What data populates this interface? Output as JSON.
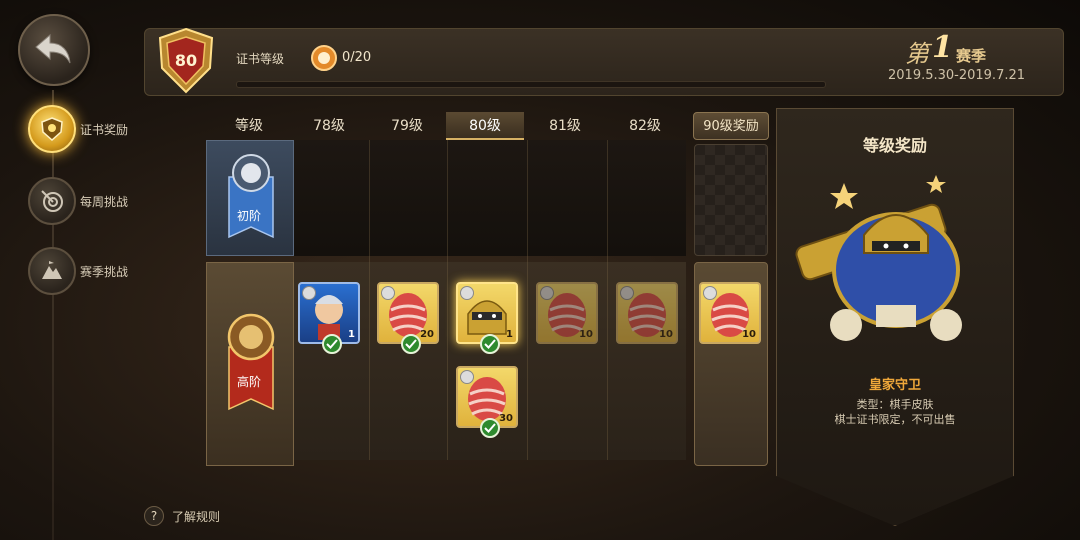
{
  "nav": {
    "items": [
      {
        "label": "证书奖励",
        "icon": "certificate-icon",
        "active": true
      },
      {
        "label": "每周挑战",
        "icon": "target-icon",
        "active": false
      },
      {
        "label": "赛季挑战",
        "icon": "mountain-icon",
        "active": false
      }
    ]
  },
  "header": {
    "level": "80",
    "cert_label": "证书等级",
    "xp_value": "0/20",
    "xp_progress": 0,
    "season_prefix": "第",
    "season_num": "1",
    "season_suffix": "赛季",
    "season_dates": "2019.5.30-2019.7.21"
  },
  "grid": {
    "columns": [
      "等级",
      "78级",
      "79级",
      "80级",
      "81级",
      "82级",
      "90级奖励"
    ],
    "current_column": "80级",
    "tiers": {
      "free": "初阶",
      "premium": "高阶"
    },
    "premium_items": [
      {
        "col": "78级",
        "kind": "skin",
        "count": "1",
        "claimed": true
      },
      {
        "col": "79级",
        "kind": "egg",
        "count": "20",
        "claimed": true
      },
      {
        "col": "80级",
        "kind": "skin-gold",
        "count": "1",
        "claimed": true
      },
      {
        "col": "80级",
        "kind": "egg",
        "count": "30",
        "claimed": true
      },
      {
        "col": "81级",
        "kind": "egg",
        "count": "10",
        "claimed": false
      },
      {
        "col": "82级",
        "kind": "egg",
        "count": "10",
        "claimed": false
      },
      {
        "col": "90级奖励",
        "kind": "egg",
        "count": "10",
        "claimed": false
      }
    ]
  },
  "panel": {
    "title": "等级奖励",
    "item_name": "皇家守卫",
    "type": "类型：棋手皮肤",
    "note": "棋士证书限定，不可出售"
  },
  "footer": {
    "help_label": "了解规则"
  },
  "colors": {
    "accent_gold": "#d8a93c",
    "item_name": "#f0a83a",
    "claimed_check": "#2e8a2e"
  }
}
